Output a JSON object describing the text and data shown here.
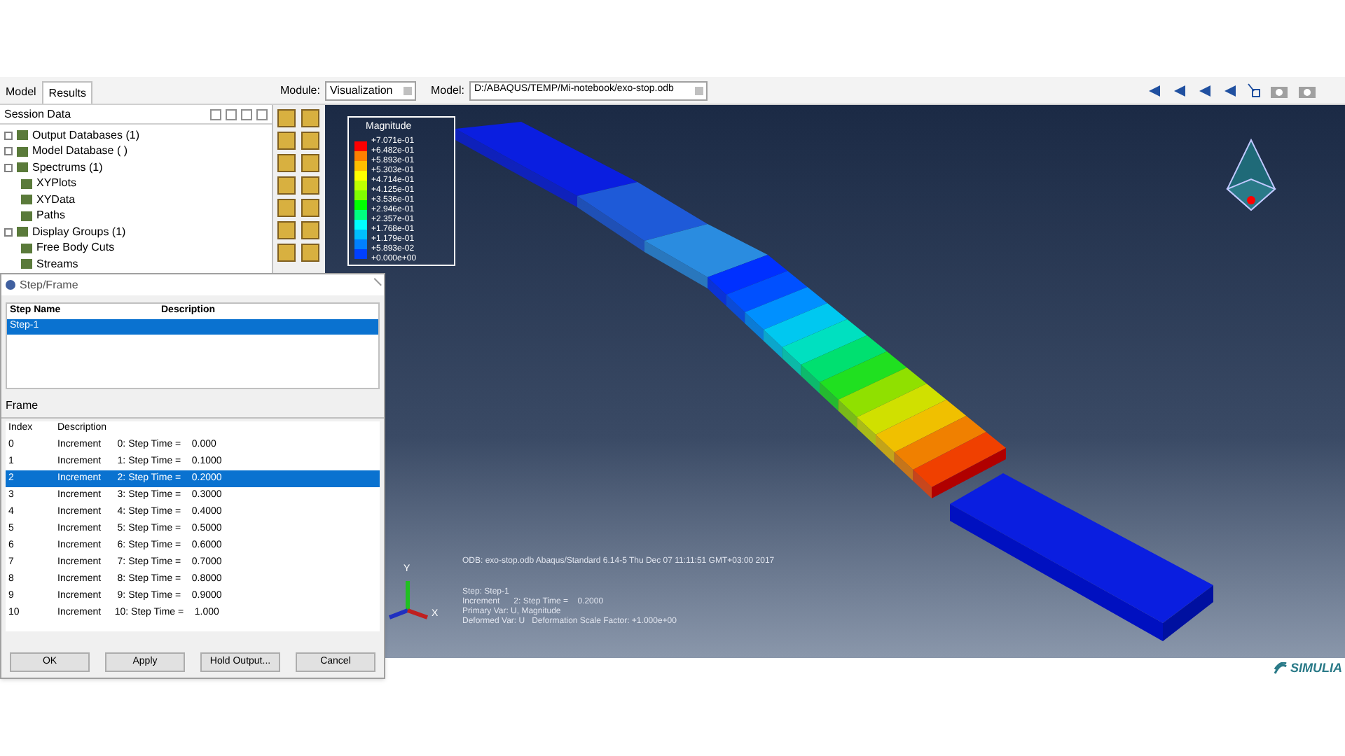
{
  "toolbar": {
    "module_label": "Module:",
    "module": "Visualization",
    "model_label": "Model:",
    "model": "D:/ABAQUS/TEMP/Mi-notebook/exo-stop.odb"
  },
  "tabs": [
    {
      "label": "Model",
      "selected": false
    },
    {
      "label": "Results",
      "selected": true
    }
  ],
  "session": {
    "title": "Session Data",
    "tree": [
      {
        "label": "Output Databases (1)",
        "kind": "expander"
      },
      {
        "label": "Model Database ( )",
        "kind": "expander"
      },
      {
        "label": "Spectrums (1)",
        "kind": "expander"
      },
      {
        "label": "XYPlots",
        "kind": "leaf"
      },
      {
        "label": "XYData",
        "kind": "leaf"
      },
      {
        "label": "Paths",
        "kind": "leaf"
      },
      {
        "label": "Display Groups (1)",
        "kind": "expander"
      },
      {
        "label": "Free Body Cuts",
        "kind": "leaf"
      },
      {
        "label": "Streams",
        "kind": "leaf"
      }
    ]
  },
  "legend": {
    "title": "Magnitude",
    "values": [
      "+7.071e-01",
      "+6.482e-01",
      "+5.893e-01",
      "+5.303e-01",
      "+4.714e-01",
      "+4.125e-01",
      "+3.536e-01",
      "+2.946e-01",
      "+2.357e-01",
      "+1.768e-01",
      "+1.179e-01",
      "+5.893e-02",
      "+0.000e+00"
    ]
  },
  "viewport_info": {
    "header": "ODB: exo-stop.odb    Abaqus/Standard 6.14-5    Thu Dec 07 11:11:51 GMT+03:00 2017",
    "lines": [
      "Step: Step-1",
      "Increment      2: Step Time =    0.2000",
      "Primary Var: U, Magnitude",
      "Deformed Var: U   Deformation Scale Factor: +1.000e+00"
    ]
  },
  "triad": {
    "y_label": "Y",
    "x_label": "X"
  },
  "dialog": {
    "title": "Step/Frame",
    "step_columns": [
      "Step Name",
      "Description"
    ],
    "steps": [
      {
        "name": "Step-1",
        "selected": true
      }
    ],
    "frame_title": "Frame",
    "frame_columns": [
      "Index",
      "Description"
    ],
    "frames": [
      {
        "index": "0",
        "description": "Increment      0: Step Time =    0.000",
        "selected": false
      },
      {
        "index": "1",
        "description": "Increment      1: Step Time =    0.1000",
        "selected": false
      },
      {
        "index": "2",
        "description": "Increment      2: Step Time =    0.2000",
        "selected": true
      },
      {
        "index": "3",
        "description": "Increment      3: Step Time =    0.3000",
        "selected": false
      },
      {
        "index": "4",
        "description": "Increment      4: Step Time =    0.4000",
        "selected": false
      },
      {
        "index": "5",
        "description": "Increment      5: Step Time =    0.5000",
        "selected": false
      },
      {
        "index": "6",
        "description": "Increment      6: Step Time =    0.6000",
        "selected": false
      },
      {
        "index": "7",
        "description": "Increment      7: Step Time =    0.7000",
        "selected": false
      },
      {
        "index": "8",
        "description": "Increment      8: Step Time =    0.8000",
        "selected": false
      },
      {
        "index": "9",
        "description": "Increment      9: Step Time =    0.9000",
        "selected": false
      },
      {
        "index": "10",
        "description": "Increment     10: Step Time =    1.000",
        "selected": false
      }
    ],
    "buttons": [
      "OK",
      "Apply",
      "Hold Output...",
      "Cancel"
    ]
  },
  "logo": "SIMULIA"
}
